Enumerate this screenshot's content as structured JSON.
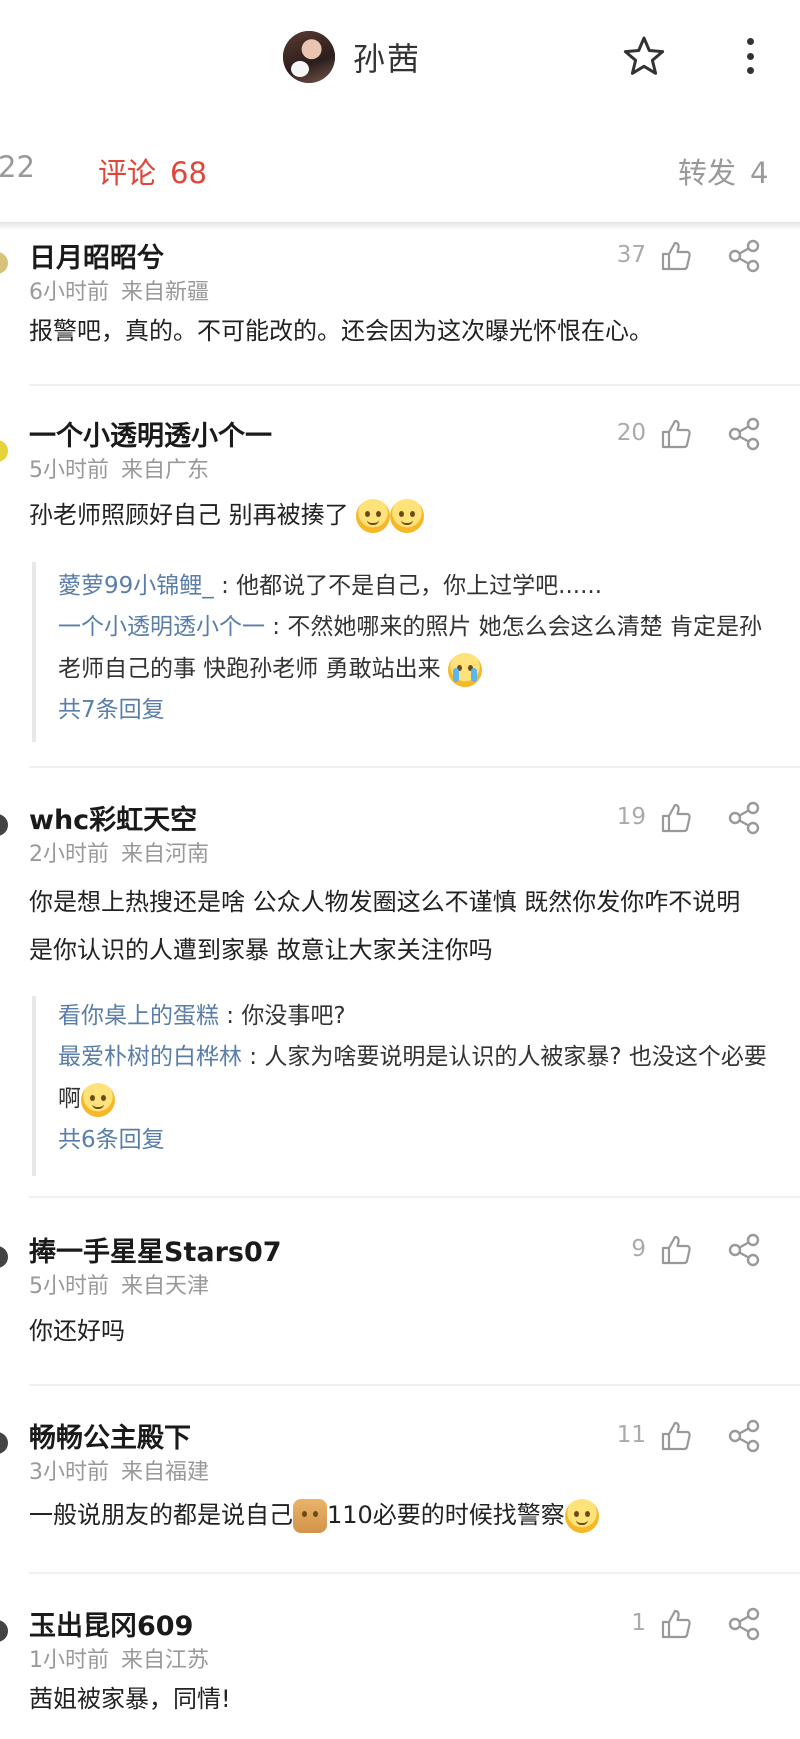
{
  "header": {
    "title": "孙茜"
  },
  "tabs": {
    "left_partial": "22",
    "comments_label": "评论",
    "comments_count": "68",
    "forward_label": "转发",
    "forward_count": "4"
  },
  "comments": [
    {
      "name": "日月昭昭兮",
      "time": "6小时前",
      "from": "来自新疆",
      "likes": "37",
      "text": "报警吧，真的。不可能改的。还会因为这次曝光怀恨在心。"
    },
    {
      "name": "一个小透明透小个一",
      "time": "5小时前",
      "from": "来自广东",
      "likes": "20",
      "text": "孙老师照顾好自己 别再被揍了",
      "replies": [
        {
          "who": "薆萝99小锦鲤_",
          "text": " : 他都说了不是自己，你上过学吧......"
        },
        {
          "who": "一个小透明透小个一",
          "text": " : 不然她哪来的照片 她怎么会这么清楚 肯定是孙老师自己的事 快跑孙老师 勇敢站出来"
        }
      ],
      "reply_total": "共7条回复"
    },
    {
      "name": "whc彩虹天空",
      "time": "2小时前",
      "from": "来自河南",
      "likes": "19",
      "text": "你是想上热搜还是啥 公众人物发圈这么不谨慎 既然你发你咋不说明是你认识的人遭到家暴 故意让大家关注你吗",
      "replies": [
        {
          "who": "看你桌上的蛋糕",
          "text": " : 你没事吧?"
        },
        {
          "who": "最爱朴树的白桦林",
          "text": " : 人家为啥要说明是认识的人被家暴? 也没这个必要啊"
        }
      ],
      "reply_total": "共6条回复"
    },
    {
      "name": "捧一手星星Stars07",
      "time": "5小时前",
      "from": "来自天津",
      "likes": "9",
      "text": "你还好吗"
    },
    {
      "name": "畅畅公主殿下",
      "time": "3小时前",
      "from": "来自福建",
      "likes": "11",
      "text_a": "一般说朋友的都是说自己",
      "text_b": "110必要的时候找警察"
    },
    {
      "name": "玉出昆冈609",
      "time": "1小时前",
      "from": "来自江苏",
      "likes": "1",
      "text": "茜姐被家暴，同情!"
    }
  ],
  "icons": {
    "like": "thumbs-up-icon",
    "share": "share-icon",
    "star": "star-icon",
    "more": "more-vertical-icon"
  },
  "colors": {
    "accent_red": "#e0453a",
    "link_blue": "#5b7ea8",
    "meta_gray": "#999999"
  }
}
